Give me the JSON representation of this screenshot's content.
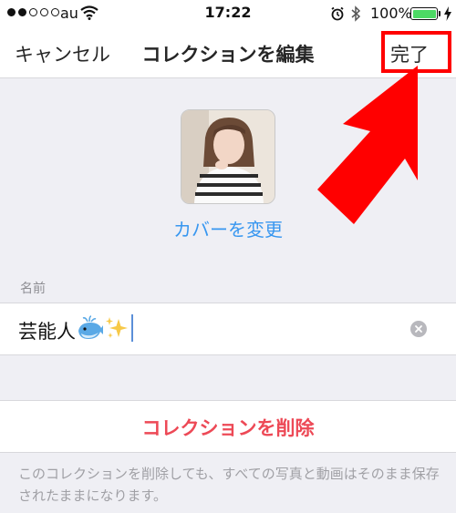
{
  "status_bar": {
    "carrier": "au",
    "time": "17:22",
    "battery_percent": "100%",
    "signal_bars_filled": 2,
    "signal_bars_total": 5
  },
  "nav": {
    "cancel_label": "キャンセル",
    "title": "コレクションを編集",
    "done_label": "完了"
  },
  "cover": {
    "change_label": "カバーを変更"
  },
  "name_field": {
    "label": "名前",
    "value": "芸能人"
  },
  "delete": {
    "button_label": "コレクションを削除",
    "note": "このコレクションを削除しても、すべての写真と動画はそのまま保存されたままになります。"
  },
  "colors": {
    "accent_blue": "#3897f0",
    "delete_red": "#ed4956",
    "annotation_red": "#ff0000",
    "battery_green": "#4cd964"
  },
  "icons": [
    "wifi-icon",
    "alarm-icon",
    "bluetooth-icon",
    "battery-icon",
    "charging-bolt-icon",
    "whale-emoji-icon",
    "sparkles-emoji-icon",
    "clear-text-icon"
  ]
}
